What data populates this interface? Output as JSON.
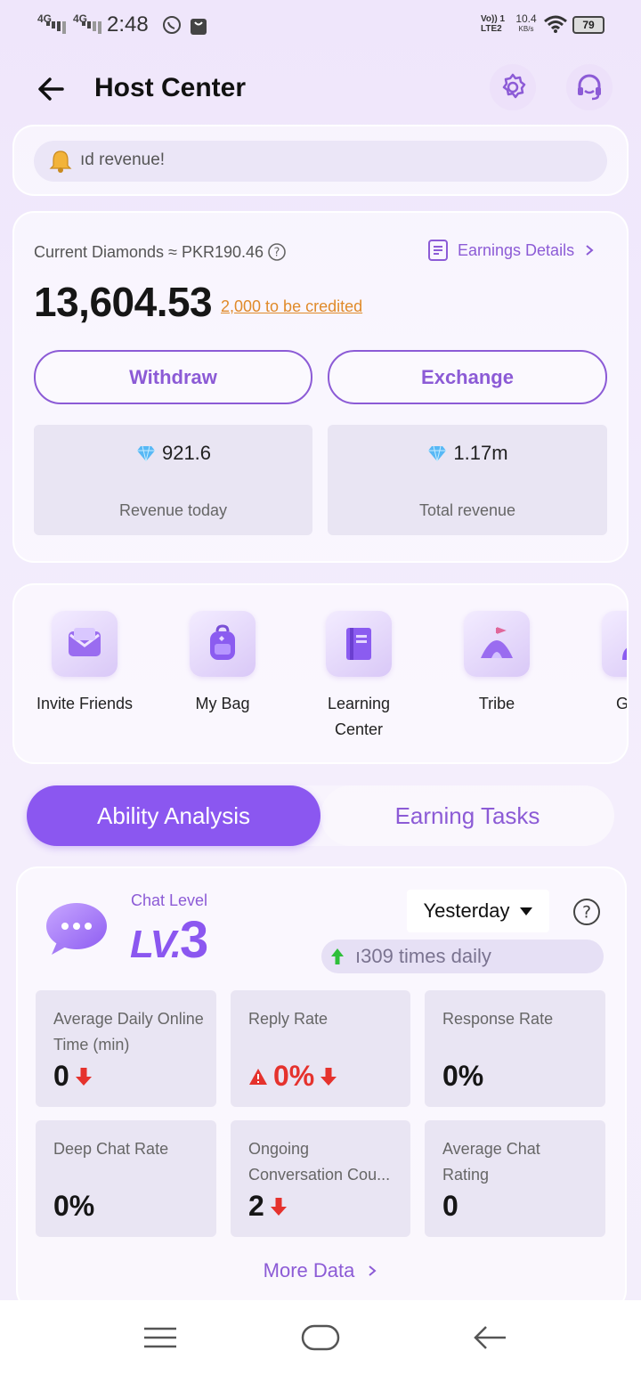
{
  "status": {
    "net1": "4G",
    "net2": "4G",
    "time": "2:48",
    "volte_top": "Vo)) 1",
    "volte_bottom": "LTE2",
    "speed_value": "10.4",
    "speed_unit": "KB/s",
    "battery": "79"
  },
  "header": {
    "title": "Host Center"
  },
  "notice": {
    "text": "ıd revenue!"
  },
  "wallet": {
    "current_label": "Current Diamonds ≈ PKR190.46",
    "earnings_link": "Earnings Details",
    "balance": "13,604.53",
    "credited": "2,000 to be credited",
    "withdraw_label": "Withdraw",
    "exchange_label": "Exchange",
    "stats": [
      {
        "value": "921.6",
        "label": "Revenue today"
      },
      {
        "value": "1.17m",
        "label": "Total revenue"
      }
    ]
  },
  "shortcuts": [
    {
      "label": "Invite Friends",
      "icon": "envelope-icon"
    },
    {
      "label": "My Bag",
      "icon": "backpack-icon"
    },
    {
      "label": "Learning Center",
      "icon": "book-icon"
    },
    {
      "label": "Tribe",
      "icon": "tent-icon"
    },
    {
      "label": "Guild",
      "icon": "person-icon"
    }
  ],
  "tabs": {
    "active": "Ability Analysis",
    "inactive": "Earning Tasks"
  },
  "ability": {
    "level_label": "Chat Level",
    "level_prefix": "LV.",
    "level_value": "3",
    "period": "Yesterday",
    "ticker": "ı309 times daily",
    "metrics": [
      {
        "label": "Average Daily Online Time (min)",
        "value": "0",
        "trend": "down",
        "warn": false
      },
      {
        "label": "Reply Rate",
        "value": "0%",
        "trend": "down",
        "warn": true
      },
      {
        "label": "Response Rate",
        "value": "0%",
        "trend": "none",
        "warn": false
      },
      {
        "label": "Deep Chat Rate",
        "value": "0%",
        "trend": "none",
        "warn": false
      },
      {
        "label": "Ongoing Conversation Cou...",
        "value": "2",
        "trend": "down",
        "warn": false
      },
      {
        "label": "Average Chat Rating",
        "value": "0",
        "trend": "none",
        "warn": false
      }
    ],
    "more_label": "More Data"
  },
  "colors": {
    "accent": "#8b57f0",
    "accent_text": "#8c5bd6",
    "credit": "#e08a2a",
    "down": "#e5322d",
    "up": "#2fbf3a"
  }
}
